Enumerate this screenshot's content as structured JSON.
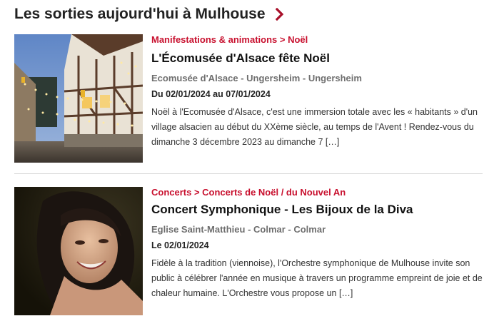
{
  "header": {
    "title": "Les sorties aujourd'hui à Mulhouse",
    "chevron_icon": "chevron-right-icon",
    "accent_color": "#c8102e"
  },
  "events": [
    {
      "category": "Manifestations & animations > Noël",
      "title": "L'Écomusée d'Alsace fête Noël",
      "venue": "Ecomusée d'Alsace - Ungersheim  -  Ungersheim",
      "dates": "Du 02/01/2024 au 07/01/2024",
      "description": "Noël à l'Ecomusée d'Alsace, c'est une immersion totale avec les « habitants » d'un village alsacien au début du XXème siècle, au temps de l'Avent ! Rendez-vous du dimanche 3 décembre 2023 au dimanche 7 […]"
    },
    {
      "category": "Concerts > Concerts de Noël / du Nouvel An",
      "title": "Concert Symphonique - Les Bijoux de la Diva",
      "venue": "Eglise Saint-Matthieu - Colmar  -  Colmar",
      "dates": "Le 02/01/2024",
      "description": "Fidèle à la tradition (viennoise), l'Orchestre symphonique de Mulhouse invite son public à célébrer l'année en musique à travers un programme empreint de joie et de chaleur humaine. L'Orchestre vous propose un […]"
    }
  ]
}
